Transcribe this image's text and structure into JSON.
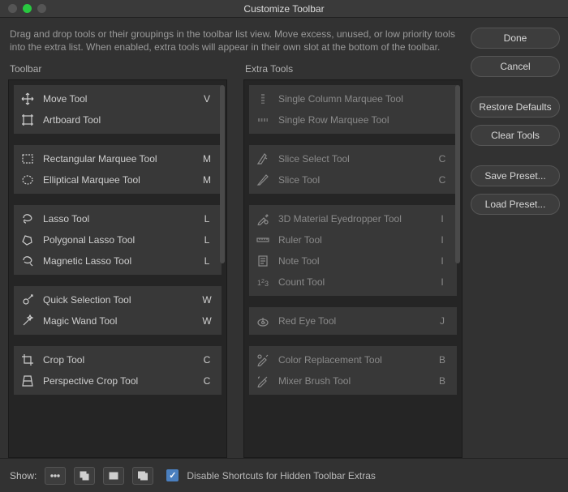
{
  "window": {
    "title": "Customize Toolbar"
  },
  "instructions": "Drag and drop tools or their groupings in the toolbar list view. Move excess, unused, or low priority tools into the extra list. When enabled, extra tools will appear in their own slot at the bottom of the toolbar.",
  "columns": {
    "toolbar": "Toolbar",
    "extra": "Extra Tools"
  },
  "toolbar_groups": [
    [
      {
        "name": "Move Tool",
        "key": "V",
        "icon": "move"
      },
      {
        "name": "Artboard Tool",
        "key": "",
        "icon": "artboard"
      }
    ],
    [
      {
        "name": "Rectangular Marquee Tool",
        "key": "M",
        "icon": "rect-marquee"
      },
      {
        "name": "Elliptical Marquee Tool",
        "key": "M",
        "icon": "ellipse-marquee"
      }
    ],
    [
      {
        "name": "Lasso Tool",
        "key": "L",
        "icon": "lasso"
      },
      {
        "name": "Polygonal Lasso Tool",
        "key": "L",
        "icon": "poly-lasso"
      },
      {
        "name": "Magnetic Lasso Tool",
        "key": "L",
        "icon": "mag-lasso"
      }
    ],
    [
      {
        "name": "Quick Selection Tool",
        "key": "W",
        "icon": "quick-sel"
      },
      {
        "name": "Magic Wand Tool",
        "key": "W",
        "icon": "wand"
      }
    ],
    [
      {
        "name": "Crop Tool",
        "key": "C",
        "icon": "crop"
      },
      {
        "name": "Perspective Crop Tool",
        "key": "C",
        "icon": "persp-crop"
      }
    ]
  ],
  "extra_groups": [
    [
      {
        "name": "Single Column Marquee Tool",
        "key": "",
        "icon": "col-marquee"
      },
      {
        "name": "Single Row Marquee Tool",
        "key": "",
        "icon": "row-marquee"
      }
    ],
    [
      {
        "name": "Slice Select Tool",
        "key": "C",
        "icon": "slice-sel"
      },
      {
        "name": "Slice Tool",
        "key": "C",
        "icon": "slice"
      }
    ],
    [
      {
        "name": "3D Material Eyedropper Tool",
        "key": "I",
        "icon": "dropper-3d"
      },
      {
        "name": "Ruler Tool",
        "key": "I",
        "icon": "ruler"
      },
      {
        "name": "Note Tool",
        "key": "I",
        "icon": "note"
      },
      {
        "name": "Count Tool",
        "key": "I",
        "icon": "count"
      }
    ],
    [
      {
        "name": "Red Eye Tool",
        "key": "J",
        "icon": "redeye"
      }
    ],
    [
      {
        "name": "Color Replacement Tool",
        "key": "B",
        "icon": "color-replace"
      },
      {
        "name": "Mixer Brush Tool",
        "key": "B",
        "icon": "mixer"
      }
    ]
  ],
  "buttons": {
    "done": "Done",
    "cancel": "Cancel",
    "restore": "Restore Defaults",
    "clear": "Clear Tools",
    "save": "Save Preset...",
    "load": "Load Preset..."
  },
  "footer": {
    "show": "Show:",
    "checkbox_label": "Disable Shortcuts for Hidden Toolbar Extras",
    "checkbox_checked": true
  }
}
